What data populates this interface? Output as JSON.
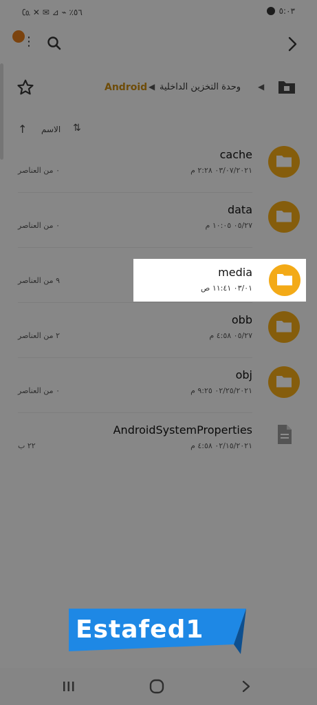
{
  "status_bar": {
    "left_text": "٥٦٪ ⌁ ⊿ ✉ ✕ ㏇",
    "time": "٥:٠٣"
  },
  "breadcrumb": {
    "current": "Android",
    "parent": "وحدة التخزين الداخلية"
  },
  "sort": {
    "label": "الاسم"
  },
  "items": [
    {
      "name": "cache",
      "date": "٠٣/٠٧/٢٠٢١ ٢:٢٨ م",
      "count": "٠ من العناصر",
      "type": "folder"
    },
    {
      "name": "data",
      "date": "٠٥/٢٧ ١٠:٠٥ م",
      "count": "٠ من العناصر",
      "type": "folder"
    },
    {
      "name": "media",
      "date": "٠٣/٠١ ١١:٤١ ص",
      "count": "٩ من العناصر",
      "type": "folder"
    },
    {
      "name": "obb",
      "date": "٠٥/٢٧ ٤:٥٨ م",
      "count": "٢ من العناصر",
      "type": "folder"
    },
    {
      "name": "obj",
      "date": "٠٢/٢٥/٢٠٢١ ٩:٢٥ م",
      "count": "٠ من العناصر",
      "type": "folder"
    },
    {
      "name": "AndroidSystemProperties",
      "date": "٠٢/١٥/٢٠٢١ ٤:٥٨ م",
      "count": "٢٢ ب",
      "type": "file"
    }
  ],
  "watermark": {
    "text": "Estafed1"
  },
  "colors": {
    "accent": "#f3aa17",
    "breadcrumb_active": "#c98a12",
    "watermark_blue": "#1e88e5"
  }
}
